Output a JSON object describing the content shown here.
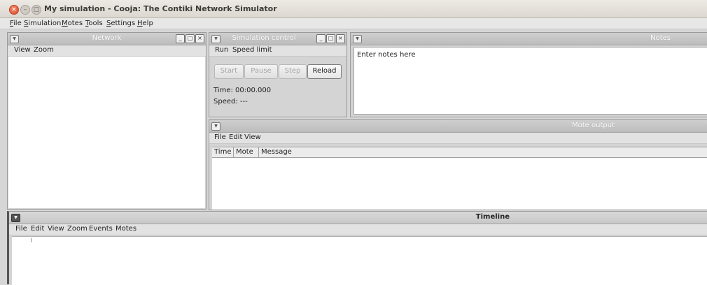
{
  "window": {
    "title": "My simulation - Cooja: The Contiki Network Simulator",
    "close_glyph": "×",
    "min_glyph": "–",
    "max_glyph": "□"
  },
  "menubar": [
    {
      "label": "File"
    },
    {
      "label": "Simulation"
    },
    {
      "label": "Motes"
    },
    {
      "label": "Tools"
    },
    {
      "label": "Settings"
    },
    {
      "label": "Help"
    }
  ],
  "frame_controls": {
    "arrow": "▼",
    "minimize": "_",
    "maximize": "□",
    "close": "×"
  },
  "network": {
    "title": "Network",
    "menu": [
      "View",
      "Zoom"
    ]
  },
  "simulation_control": {
    "title": "Simulation control",
    "menu": [
      "Run",
      "Speed limit"
    ],
    "buttons": {
      "start": "Start",
      "pause": "Pause",
      "step": "Step",
      "reload": "Reload"
    },
    "time": "Time: 00:00.000",
    "speed": "Speed: ---"
  },
  "notes": {
    "title": "Notes",
    "text": "Enter notes here"
  },
  "mote_output": {
    "title": "Mote output",
    "menu": [
      "File",
      "Edit",
      "View"
    ],
    "columns": [
      "Time",
      "Mote",
      "Message"
    ]
  },
  "timeline": {
    "title": "Timeline",
    "menu": [
      "File",
      "Edit",
      "View",
      "Zoom",
      "Events",
      "Motes"
    ]
  }
}
